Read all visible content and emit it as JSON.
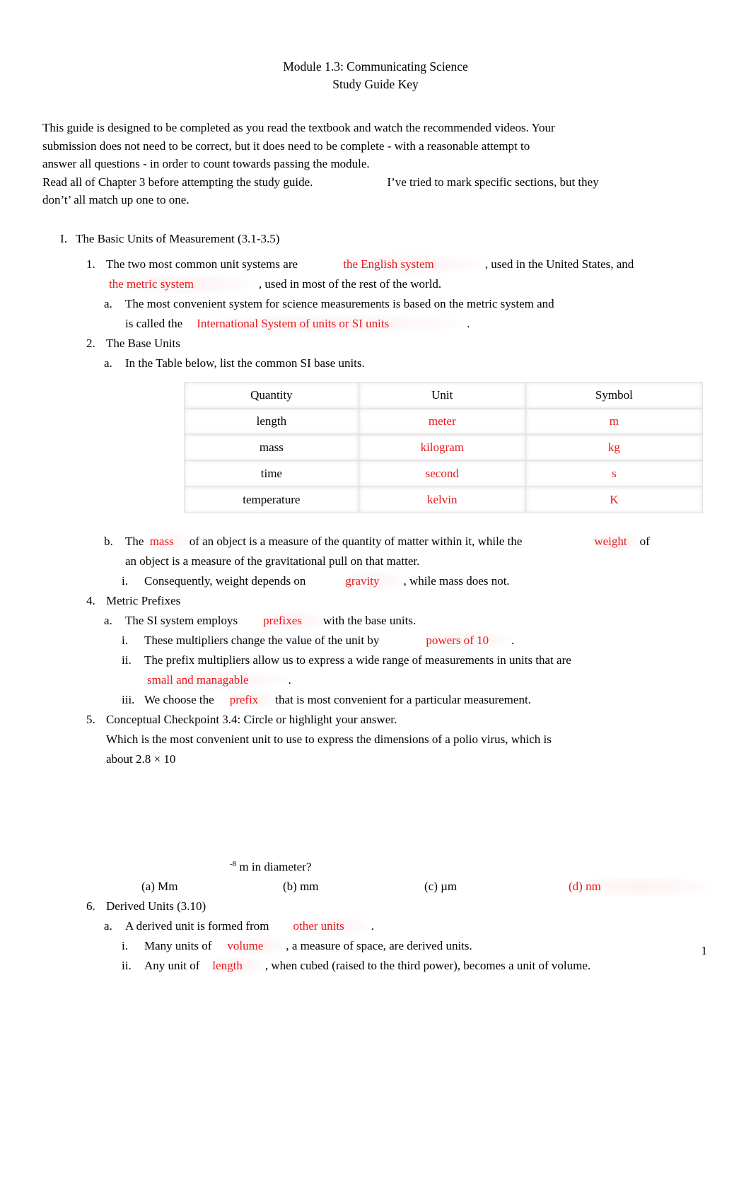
{
  "document": {
    "title_line_1": "Module 1.3: Communicating Science",
    "title_line_2": "Study Guide Key",
    "page_number": "1"
  },
  "intro": {
    "line_1": "This guide is designed to be completed as you read the textbook and watch the recommended videos. Your",
    "line_2": "submission does not need to be correct, but it does need to be complete - with a reasonable attempt to",
    "line_3": "answer all questions - in order to count towards passing the module.",
    "line_4_a": "Read all of Chapter 3 before attempting the study guide.",
    "line_4_b": "I’ve tried to mark specific sections, but they",
    "line_5": "don’t’ all match up one to one."
  },
  "section_I": {
    "marker": "I.",
    "heading": "The Basic Units of Measurement (3.1-3.5)",
    "item_1": {
      "marker": "1.",
      "text_a": "The two most common unit systems are",
      "answer_1": "the English system",
      "text_b": ", used in the United States, and",
      "answer_2": "the metric system",
      "text_c": ", used in most of the rest of the world.",
      "sub_a": {
        "marker": "a.",
        "text_a": "The most convenient system for science measurements is based on the metric system and",
        "text_b": "is called the",
        "answer": "International System of units or SI units",
        "text_c": "."
      }
    },
    "item_2": {
      "marker": "2.",
      "heading": "The Base Units",
      "sub_a": {
        "marker": "a.",
        "text": "In the Table below, list the common SI base units."
      },
      "table": {
        "headers": [
          "Quantity",
          "Unit",
          "Symbol"
        ],
        "rows": [
          {
            "quantity": "length",
            "unit": "meter",
            "symbol": "m"
          },
          {
            "quantity": "mass",
            "unit": "kilogram",
            "symbol": "kg"
          },
          {
            "quantity": "time",
            "unit": "second",
            "symbol": "s"
          },
          {
            "quantity": "temperature",
            "unit": "kelvin",
            "symbol": "K"
          }
        ]
      },
      "sub_b": {
        "marker": "b.",
        "text_a": "The",
        "answer_1": "mass",
        "text_b": "of an object is a measure of the quantity of matter within it, while the",
        "answer_2": "weight",
        "text_c": "of",
        "text_d": "an object is a measure of the gravitational pull on that matter.",
        "sub_i": {
          "marker": "i.",
          "text_a": "Consequently, weight depends on",
          "answer": "gravity",
          "text_b": ", while mass does not."
        }
      }
    },
    "item_4": {
      "marker": "4.",
      "heading": "Metric Prefixes",
      "sub_a": {
        "marker": "a.",
        "text_a": "The SI system employs",
        "answer": "prefixes",
        "text_b": "with the base units.",
        "sub_i": {
          "marker": "i.",
          "text_a": "These multipliers change the value of the unit by",
          "answer": "powers of 10",
          "text_b": "."
        },
        "sub_ii": {
          "marker": "ii.",
          "text_a": "The prefix multipliers allow us to express a wide range of measurements in units that are",
          "answer": "small and managable",
          "text_b": "."
        },
        "sub_iii": {
          "marker": "iii.",
          "text_a": "We choose the",
          "answer": "prefix",
          "text_b": "that is most convenient for a particular measurement."
        }
      }
    },
    "item_5": {
      "marker": "5.",
      "heading": "Conceptual Checkpoint 3.4: Circle or highlight your answer.",
      "question_line_1": "Which is the most convenient unit to use to express the dimensions of a polio virus, which is",
      "question_line_2": "about 2.8 × 10",
      "exponent": "-8",
      "question_line_3": "m in diameter?",
      "choices": [
        {
          "label": "(a)  Mm",
          "selected": false
        },
        {
          "label": "(b) mm",
          "selected": false
        },
        {
          "label": "(c) µm",
          "selected": false
        },
        {
          "label": "(d) nm",
          "selected": true
        }
      ]
    },
    "item_6": {
      "marker": "6.",
      "heading": "Derived Units (3.10)",
      "sub_a": {
        "marker": "a.",
        "text_a": "A derived unit is formed from",
        "answer": "other units",
        "text_b": ".",
        "sub_i": {
          "marker": "i.",
          "text_a": "Many units of",
          "answer": "volume",
          "text_b": ", a measure of space, are derived units."
        },
        "sub_ii": {
          "marker": "ii.",
          "text_a": "Any unit of",
          "answer": "length",
          "text_b": ", when cubed (raised to the third power), becomes a unit of volume."
        }
      }
    }
  },
  "colors": {
    "answer_red": "#e8161b",
    "text_black": "#000000",
    "table_border": "#e2e2e2"
  }
}
